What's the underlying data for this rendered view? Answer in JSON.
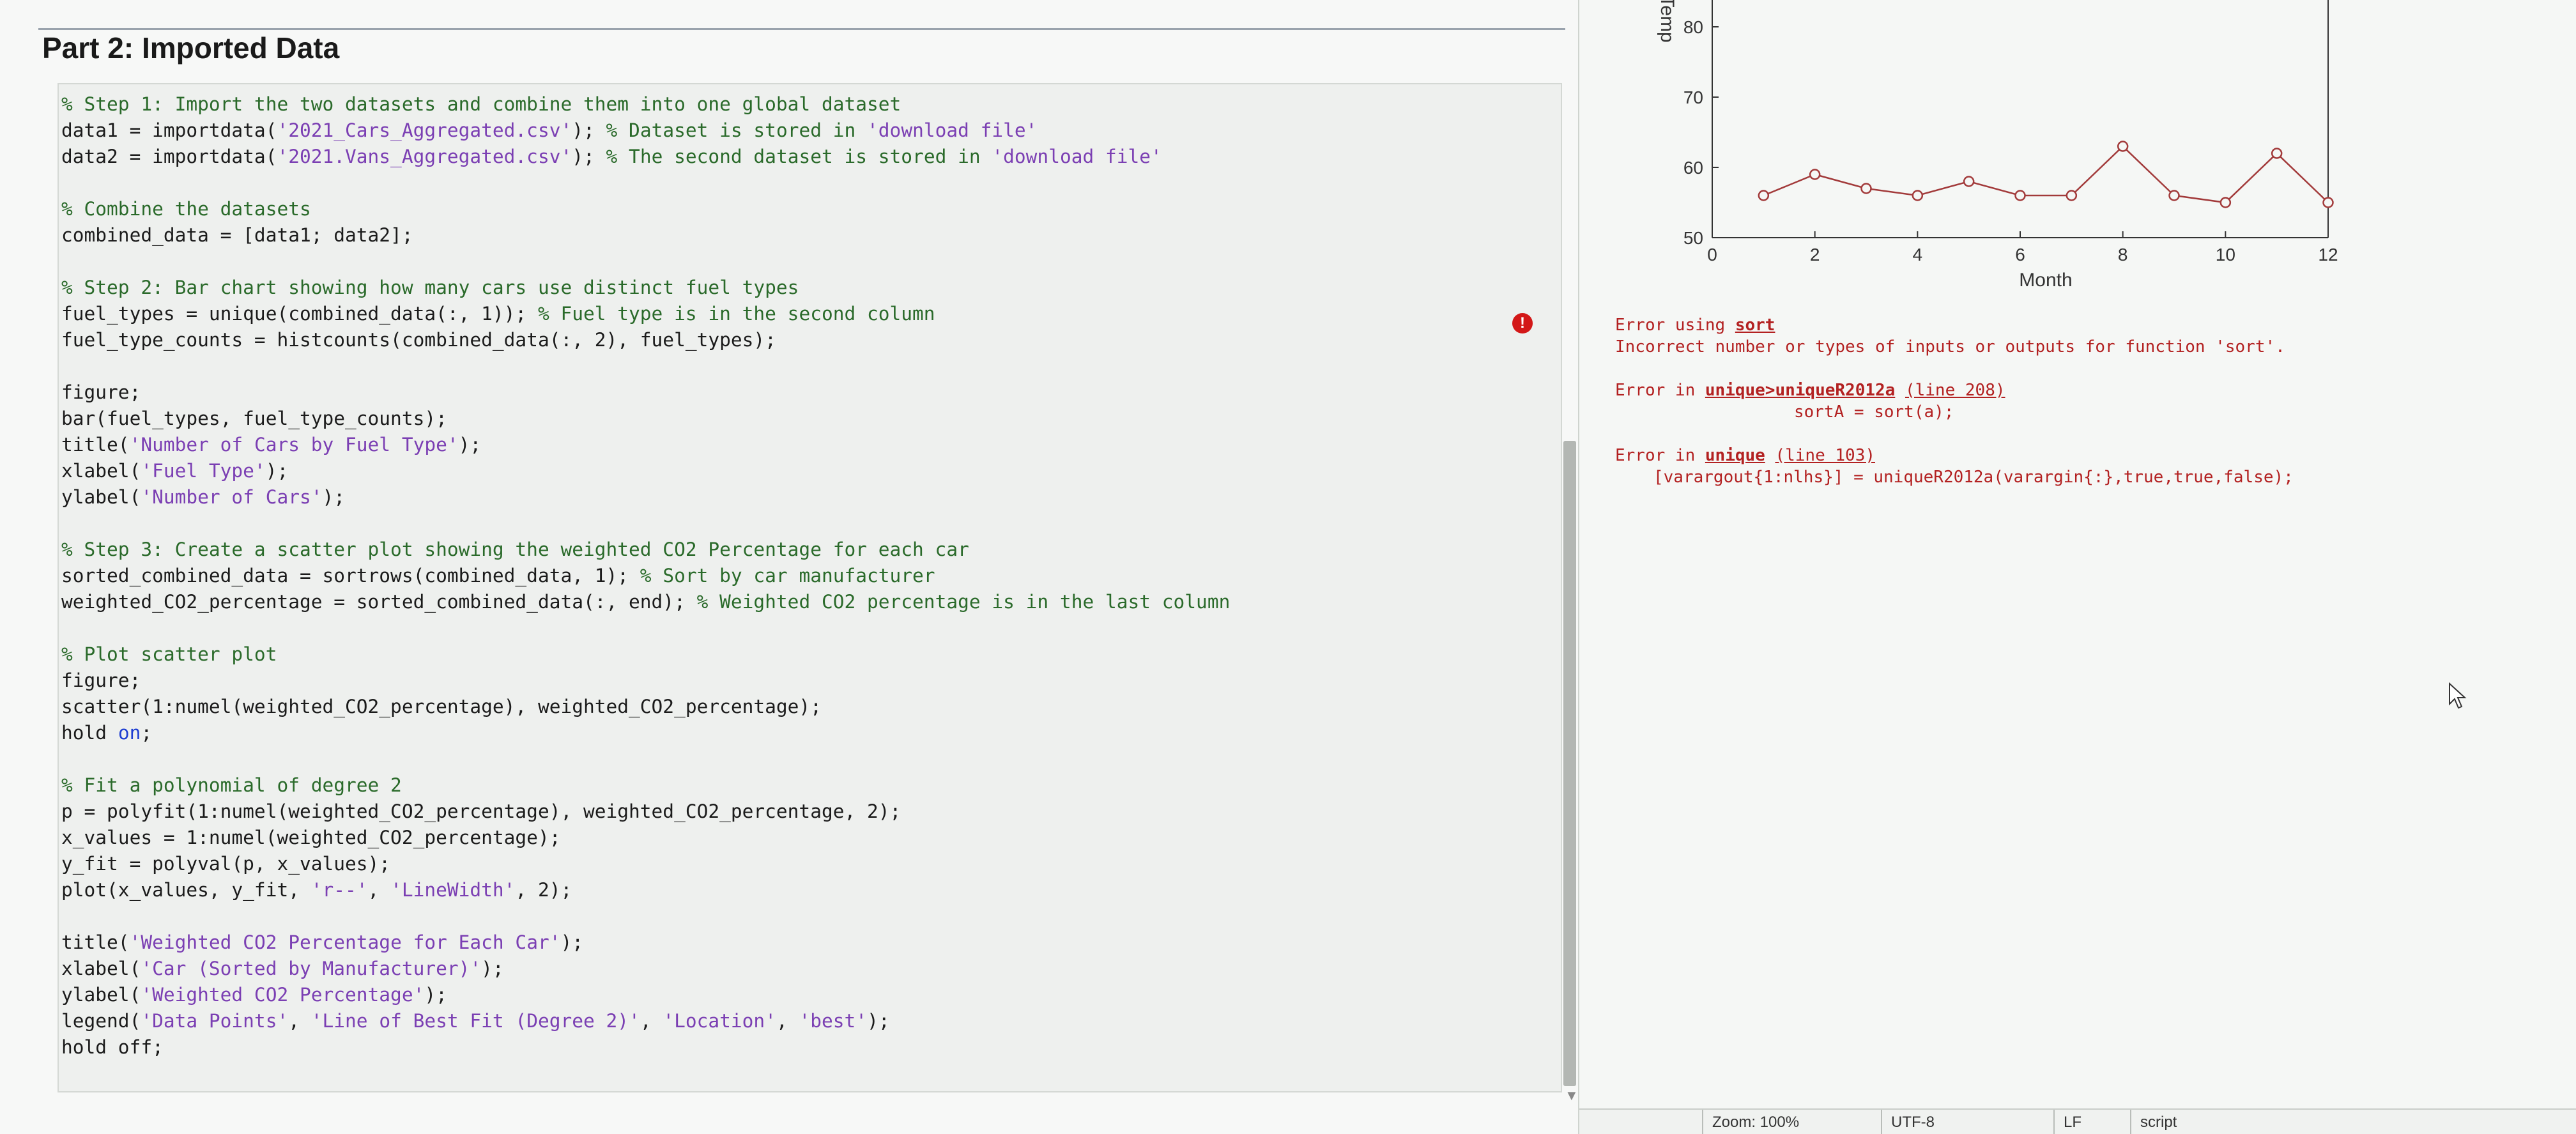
{
  "section": {
    "title": "Part 2: Imported Data"
  },
  "code_lines": [
    {
      "t": "% Step 1: Import the two datasets and combine them into one global dataset",
      "c": "cm"
    },
    {
      "t": "data1 = importdata('2021_Cars_Aggregated.csv'); % Dataset is stored in 'download file'",
      "c": ""
    },
    {
      "t": "data2 = importdata('2021.Vans_Aggregated.csv'); % The second dataset is stored in 'download file'",
      "c": ""
    },
    {
      "t": "",
      "c": ""
    },
    {
      "t": "% Combine the datasets",
      "c": "cm"
    },
    {
      "t": "combined_data = [data1; data2];",
      "c": ""
    },
    {
      "t": "",
      "c": ""
    },
    {
      "t": "% Step 2: Bar chart showing how many cars use distinct fuel types",
      "c": "cm"
    },
    {
      "t": "fuel_types = unique(combined_data(:, 1)); % Fuel type is in the second column",
      "c": ""
    },
    {
      "t": "fuel_type_counts = histcounts(combined_data(:, 2), fuel_types);",
      "c": ""
    },
    {
      "t": "",
      "c": ""
    },
    {
      "t": "figure;",
      "c": ""
    },
    {
      "t": "bar(fuel_types, fuel_type_counts);",
      "c": ""
    },
    {
      "t": "title('Number of Cars by Fuel Type');",
      "c": ""
    },
    {
      "t": "xlabel('Fuel Type');",
      "c": ""
    },
    {
      "t": "ylabel('Number of Cars');",
      "c": ""
    },
    {
      "t": "",
      "c": ""
    },
    {
      "t": "% Step 3: Create a scatter plot showing the weighted CO2 Percentage for each car",
      "c": "cm"
    },
    {
      "t": "sorted_combined_data = sortrows(combined_data, 1); % Sort by car manufacturer",
      "c": ""
    },
    {
      "t": "weighted_CO2_percentage = sorted_combined_data(:, end); % Weighted CO2 percentage is in the last column",
      "c": ""
    },
    {
      "t": "",
      "c": ""
    },
    {
      "t": "% Plot scatter plot",
      "c": "cm"
    },
    {
      "t": "figure;",
      "c": ""
    },
    {
      "t": "scatter(1:numel(weighted_CO2_percentage), weighted_CO2_percentage);",
      "c": ""
    },
    {
      "t": "hold on;",
      "c": ""
    },
    {
      "t": "",
      "c": ""
    },
    {
      "t": "% Fit a polynomial of degree 2",
      "c": "cm"
    },
    {
      "t": "p = polyfit(1:numel(weighted_CO2_percentage), weighted_CO2_percentage, 2);",
      "c": ""
    },
    {
      "t": "x_values = 1:numel(weighted_CO2_percentage);",
      "c": ""
    },
    {
      "t": "y_fit = polyval(p, x_values);",
      "c": ""
    },
    {
      "t": "plot(x_values, y_fit, 'r--', 'LineWidth', 2);",
      "c": ""
    },
    {
      "t": "",
      "c": ""
    },
    {
      "t": "title('Weighted CO2 Percentage for Each Car');",
      "c": ""
    },
    {
      "t": "xlabel('Car (Sorted by Manufacturer)');",
      "c": ""
    },
    {
      "t": "ylabel('Weighted CO2 Percentage');",
      "c": ""
    },
    {
      "t": "legend('Data Points', 'Line of Best Fit (Degree 2)', 'Location', 'best');",
      "c": ""
    },
    {
      "t": "hold off;",
      "c": ""
    }
  ],
  "errors": {
    "e1_prefix": "Error using ",
    "e1_func": "sort",
    "e1_msg": "Incorrect number or types of inputs or outputs for function 'sort'.",
    "e2_prefix": "Error in ",
    "e2_func": "unique>uniqueR2012a",
    "e2_loc": "(line 208)",
    "e2_code": "sortA = sort(a);",
    "e3_prefix": "Error in ",
    "e3_func": "unique",
    "e3_loc": "(line 103)",
    "e3_code": "[varargout{1:nlhs}] = uniqueR2012a(varargin{:},true,true,false);"
  },
  "statusbar": {
    "zoom": "Zoom: 100%",
    "encoding": "UTF-8",
    "line_ending": "LF",
    "mode": "script"
  },
  "chart_data": {
    "type": "line",
    "x": [
      1,
      2,
      3,
      4,
      5,
      6,
      7,
      8,
      9,
      10,
      11,
      12
    ],
    "series": [
      {
        "values": [
          56,
          59,
          57,
          56,
          58,
          56,
          56,
          63,
          56,
          55,
          62,
          55
        ]
      }
    ],
    "ylabel": "Temp",
    "xlabel": "Month",
    "xlim": [
      0,
      12
    ],
    "ylim": [
      50,
      85
    ],
    "xticks": [
      "0",
      "2",
      "4",
      "6",
      "8",
      "10",
      "12"
    ],
    "yticks": [
      "50",
      "60",
      "70",
      "80"
    ],
    "color": "#a23a3a"
  }
}
